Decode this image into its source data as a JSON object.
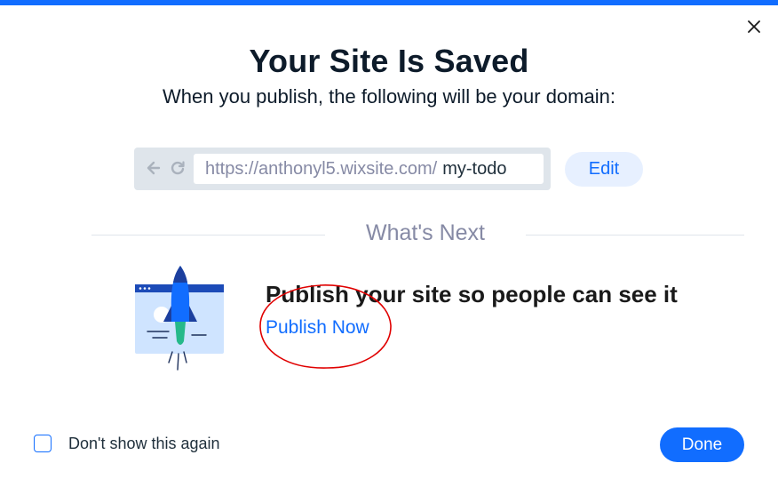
{
  "dialog": {
    "title": "Your Site Is Saved",
    "subtitle": "When you publish, the following will be your domain:"
  },
  "domain": {
    "base_url": "https://anthonyl5.wixsite.com/",
    "slug": "my-todo",
    "edit_label": "Edit"
  },
  "whats_next": {
    "heading": "What's Next",
    "headline": "Publish your site so people can see it",
    "publish_link": "Publish Now"
  },
  "footer": {
    "checkbox_label": "Don't show this again",
    "checkbox_checked": false,
    "done_label": "Done"
  },
  "icons": {
    "close": "close-icon",
    "back": "arrow-left-icon",
    "refresh": "refresh-icon",
    "illustration": "rocket-illustration"
  },
  "colors": {
    "accent": "#116dff",
    "accent_light": "#e7f0ff",
    "annotation": "#e00000"
  }
}
